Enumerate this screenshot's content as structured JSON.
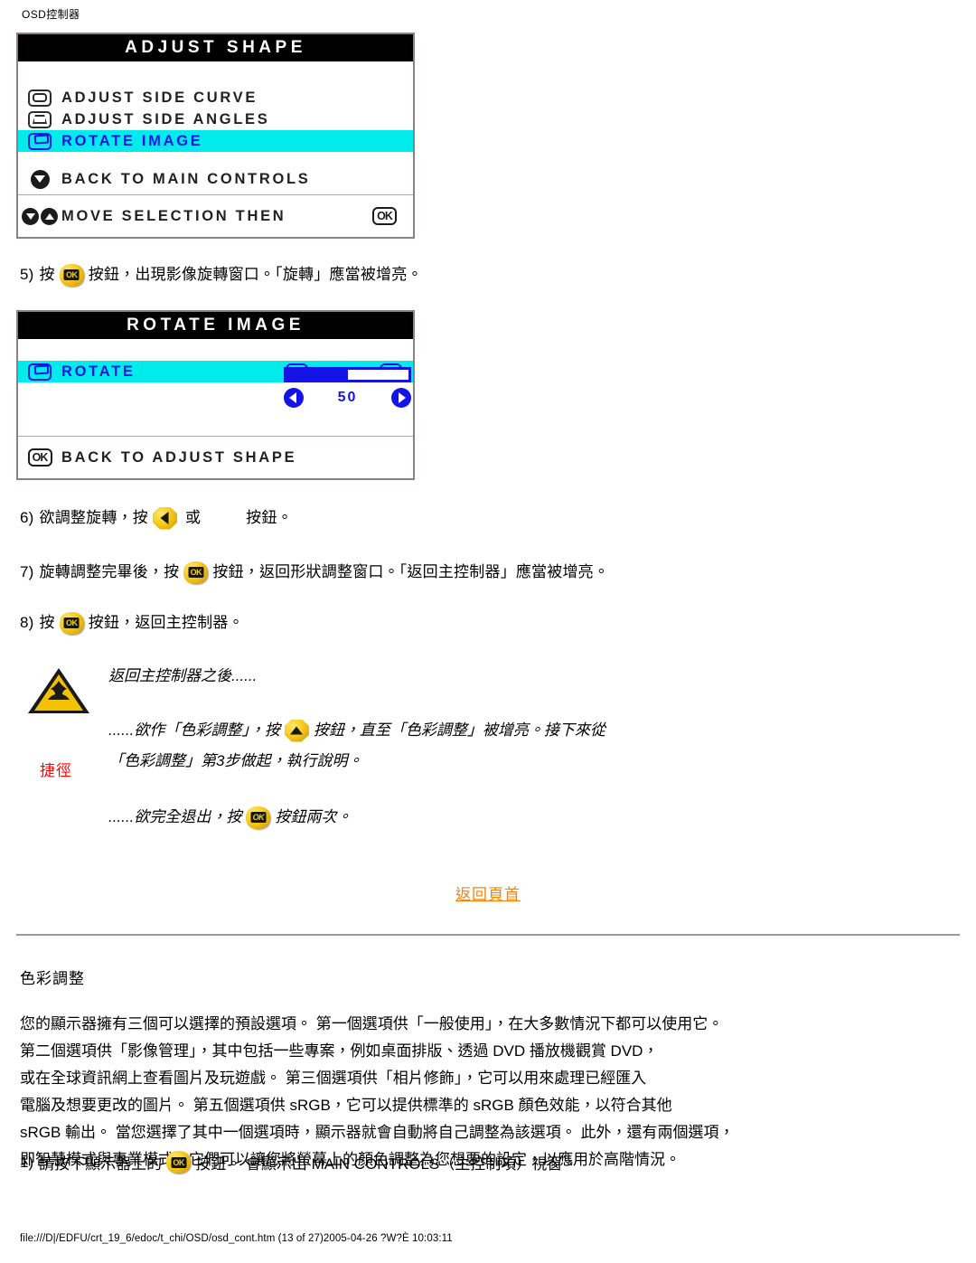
{
  "document": {
    "header": "OSD控制器",
    "footer_path": "file:///D|/EDFU/crt_19_6/edoc/t_chi/OSD/osd_cont.htm (13 of 27)2005-04-26 ?W?È  10:03:11"
  },
  "osd_panels": [
    {
      "id": "adjust-shape",
      "title": "ADJUST SHAPE",
      "rows": [
        {
          "icon": "monitor-curve-icon",
          "label": "ADJUST SIDE CURVE",
          "highlighted": false
        },
        {
          "icon": "monitor-angles-icon",
          "label": "ADJUST SIDE ANGLES",
          "highlighted": false
        },
        {
          "icon": "monitor-rotate-icon",
          "label": "ROTATE IMAGE",
          "highlighted": true
        },
        {
          "icon": "arrow-down-circle-icon",
          "label": "BACK TO MAIN CONTROLS",
          "highlighted": false
        }
      ],
      "footer": {
        "label": "MOVE SELECTION THEN",
        "ok_label": "OK"
      }
    },
    {
      "id": "rotate-image",
      "title": "ROTATE IMAGE",
      "rows": [
        {
          "icon": "monitor-rotate-icon",
          "label": "ROTATE",
          "highlighted": true
        }
      ],
      "slider": {
        "value": "50",
        "percent": 50
      },
      "footer": {
        "label": "BACK TO ADJUST SHAPE",
        "ok_label": "OK"
      }
    }
  ],
  "steps": [
    {
      "num": "5)",
      "before": "按",
      "button": "osd-menu-button",
      "after": "按鈕，出現影像旋轉窗口。「旋轉」應當被增亮。"
    },
    {
      "num": "6)",
      "before": "欲調整旋轉，按",
      "button": "left-arrow-button",
      "middle": "或",
      "missing": true,
      "after": "按鈕。"
    },
    {
      "num": "7)",
      "before": "旋轉調整完畢後，按",
      "button": "osd-menu-button",
      "after": "按鈕，返回形狀調整窗口。「返回主控制器」應當被增亮。"
    },
    {
      "num": "8)",
      "before": "按",
      "button": "osd-menu-button",
      "after": "按鈕，返回主控制器。"
    }
  ],
  "tip": {
    "icon": "warning-triangle-icon",
    "label": "捷徑",
    "line1": "返回主控制器之後......",
    "line2_a": "......欲作「色彩調整」，按",
    "line2_button": "up-arrow-button",
    "line2_b": "按鈕，直至「色彩調整」被增亮。接下來從",
    "line3": "「色彩調整」第3步做起，執行說明。",
    "line4_a": "......欲完全退出，按",
    "line4_button": "osd-menu-button",
    "line4_b": "按鈕兩次。"
  },
  "back_to_top": "返回頁首",
  "section": {
    "title": "色彩調整",
    "paragraph_lines": [
      "您的顯示器擁有三個可以選擇的預設選項。 第一個選項供「一般使用」，在大多數情況下都可以使用它。",
      "第二個選項供「影像管理」，其中包括一些專案，例如桌面排版、透過 DVD 播放機觀賞 DVD，",
      "或在全球資訊網上查看圖片及玩遊戲。 第三個選項供「相片修飾」，它可以用來處理已經匯入",
      "電腦及想要更改的圖片。 第五個選項供 sRGB，它可以提供標準的 sRGB 顏色效能，以符合其他",
      "sRGB 輸出。 當您選擇了其中一個選項時，顯示器就會自動將自己調整為該選項。 此外，還有兩個選項，",
      "即智慧模式與專業模式，它們可以讓您將螢幕上的顏色調整為您想要的設定，以應用於高階情況。"
    ],
    "final_step": {
      "num": "1)",
      "before": "請按下顯示器上的",
      "button": "osd-menu-button",
      "after": "按鈕。 會顯示出 MAIN CONTROLS（主控制項）視窗。"
    }
  },
  "colors": {
    "highlight": "#00ecec",
    "osd_blue": "#1414e6",
    "link_orange": "#ff8000",
    "tip_red": "#ff0000",
    "button_yellow": "#f5c718"
  }
}
